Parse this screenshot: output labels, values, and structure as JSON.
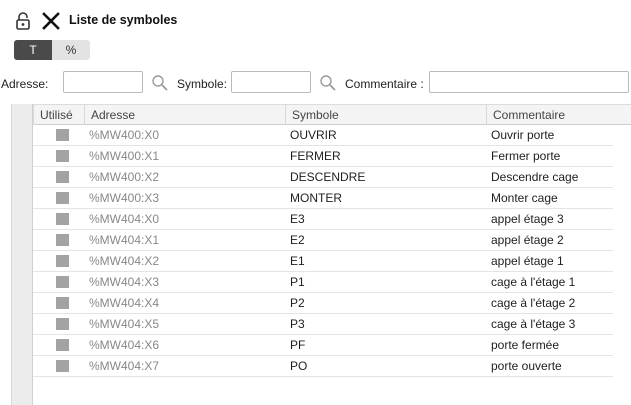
{
  "header": {
    "title": "Liste de symboles",
    "icons": [
      "lock-icon",
      "close-icon"
    ]
  },
  "view_toggle": {
    "options": [
      "T",
      "%"
    ],
    "selected": "T"
  },
  "filters": {
    "address_label": "Adresse:",
    "address_value": "",
    "symbol_label": "Symbole:",
    "symbol_value": "",
    "comment_label": "Commentaire :",
    "comment_value": ""
  },
  "table": {
    "columns": [
      "Utilisé",
      "Adresse",
      "Symbole",
      "Commentaire"
    ],
    "rows": [
      {
        "address": "%MW400:X0",
        "symbol": "OUVRIR",
        "comment": "Ouvrir porte"
      },
      {
        "address": "%MW400:X1",
        "symbol": "FERMER",
        "comment": "Fermer porte"
      },
      {
        "address": "%MW400:X2",
        "symbol": "DESCENDRE",
        "comment": "Descendre cage"
      },
      {
        "address": "%MW400:X3",
        "symbol": "MONTER",
        "comment": "Monter cage"
      },
      {
        "address": "%MW404:X0",
        "symbol": "E3",
        "comment": "appel étage 3"
      },
      {
        "address": "%MW404:X1",
        "symbol": "E2",
        "comment": "appel étage 2"
      },
      {
        "address": "%MW404:X2",
        "symbol": "E1",
        "comment": "appel étage 1"
      },
      {
        "address": "%MW404:X3",
        "symbol": "P1",
        "comment": "cage à l'étage 1"
      },
      {
        "address": "%MW404:X4",
        "symbol": "P2",
        "comment": "cage à l'étage 2"
      },
      {
        "address": "%MW404:X5",
        "symbol": "P3",
        "comment": "cage à l'étage 3"
      },
      {
        "address": "%MW404:X6",
        "symbol": "PF",
        "comment": "porte fermée"
      },
      {
        "address": "%MW404:X7",
        "symbol": "PO",
        "comment": "porte ouverte"
      }
    ]
  }
}
